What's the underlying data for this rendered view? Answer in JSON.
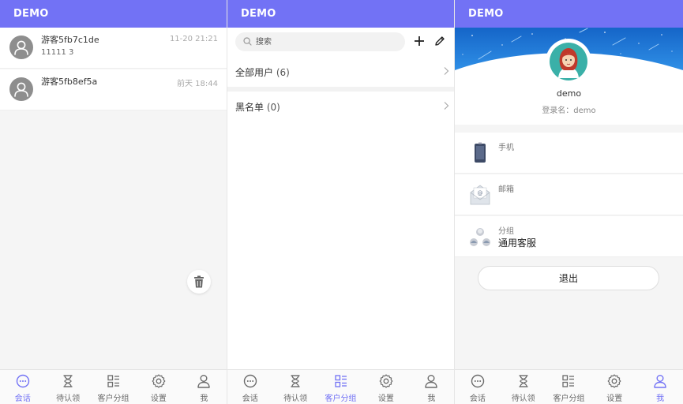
{
  "colors": {
    "accent": "#7272f5",
    "tab_inactive": "#6b6b6b"
  },
  "panel1": {
    "header": "DEMO",
    "conversations": [
      {
        "name": "游客5fb7c1de",
        "preview": "11111 3",
        "time": "11-20 21:21"
      },
      {
        "name": "游客5fb8ef5a",
        "preview": "",
        "time": "前天 18:44"
      }
    ],
    "trash_icon": "trash-icon"
  },
  "panel2": {
    "header": "DEMO",
    "search_placeholder": "搜索",
    "groups": [
      {
        "label": "全部用户",
        "count": "(6)"
      },
      {
        "label": "黑名单",
        "count": "(0)"
      }
    ]
  },
  "panel3": {
    "header": "DEMO",
    "profile": {
      "name": "demo",
      "login_label": "登录名：demo"
    },
    "rows": [
      {
        "icon": "phone-icon",
        "label": "手机",
        "value": ""
      },
      {
        "icon": "mail-icon",
        "label": "邮箱",
        "value": ""
      },
      {
        "icon": "group-icon",
        "label": "分组",
        "value": "通用客服"
      }
    ],
    "logout_label": "退出"
  },
  "tabs": [
    {
      "icon": "chat-icon",
      "label": "会话"
    },
    {
      "icon": "hourglass-icon",
      "label": "待认领"
    },
    {
      "icon": "list-icon",
      "label": "客户分组"
    },
    {
      "icon": "gear-icon",
      "label": "设置"
    },
    {
      "icon": "user-icon",
      "label": "我"
    }
  ],
  "active_tabs": {
    "panel1": 0,
    "panel2": 2,
    "panel3": 4
  }
}
